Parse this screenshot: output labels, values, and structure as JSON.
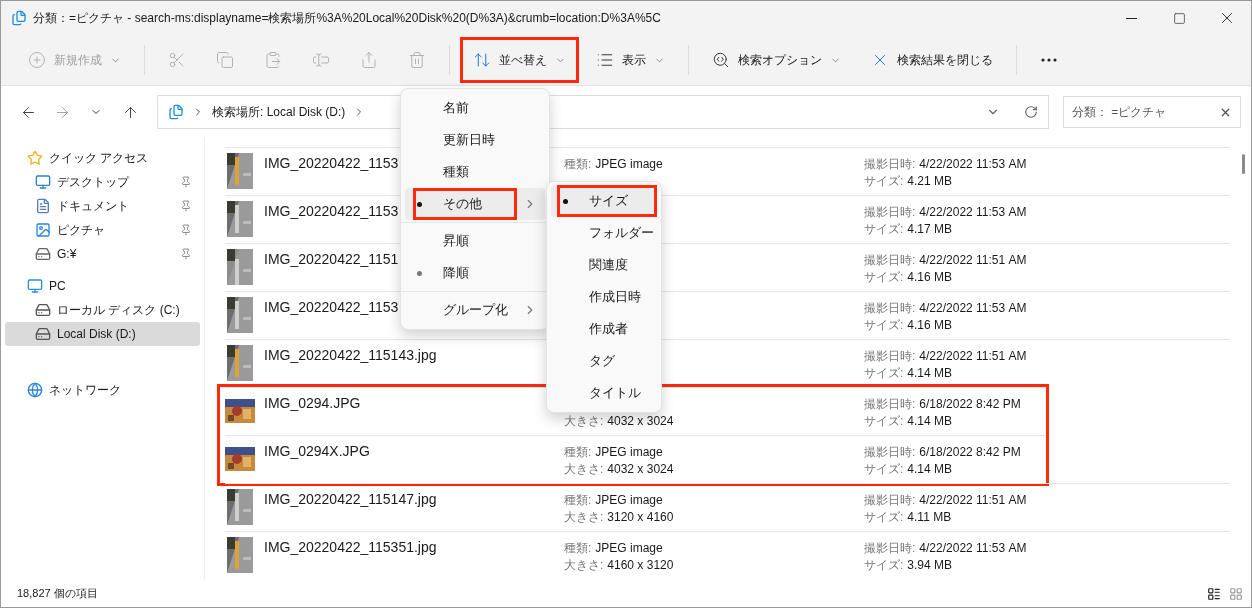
{
  "window": {
    "title": "分類：=ピクチャ - search-ms:displayname=検索場所%3A%20Local%20Disk%20(D%3A)&crumb=location:D%3A%5C"
  },
  "toolbar": [
    {
      "kind": "new",
      "label": "新規作成",
      "disabled": true,
      "dropdown": true,
      "highlighted": false
    },
    {
      "kind": "divider"
    },
    {
      "kind": "cut",
      "disabled": true
    },
    {
      "kind": "copy",
      "disabled": true
    },
    {
      "kind": "paste",
      "disabled": true
    },
    {
      "kind": "rename",
      "disabled": true
    },
    {
      "kind": "share",
      "disabled": true
    },
    {
      "kind": "delete",
      "disabled": true
    },
    {
      "kind": "divider"
    },
    {
      "kind": "sort",
      "label": "並べ替え",
      "disabled": false,
      "dropdown": true,
      "highlighted": true
    },
    {
      "kind": "view",
      "label": "表示",
      "disabled": false,
      "dropdown": true,
      "highlighted": false
    },
    {
      "kind": "divider"
    },
    {
      "kind": "search-options",
      "label": "検索オプション",
      "disabled": false,
      "dropdown": true,
      "highlighted": false
    },
    {
      "kind": "close-search",
      "label": "検索結果を閉じる",
      "disabled": false,
      "dropdown": false,
      "highlighted": false
    },
    {
      "kind": "divider"
    },
    {
      "kind": "more",
      "disabled": false
    }
  ],
  "address": {
    "crumbs": [
      "検索場所: Local Disk (D:)"
    ]
  },
  "search": {
    "value": "分類： =ピクチャ"
  },
  "sidebar": {
    "items": [
      {
        "kind": "star",
        "label": "クイック アクセス",
        "selected": false,
        "children": [
          {
            "kind": "desktop",
            "label": "デスクトップ",
            "pinned": true,
            "selected": false
          },
          {
            "kind": "documents",
            "label": "ドキュメント",
            "pinned": true,
            "selected": false
          },
          {
            "kind": "pictures",
            "label": "ピクチャ",
            "pinned": true,
            "selected": false
          },
          {
            "kind": "netdrive",
            "label": "G:¥",
            "pinned": true,
            "selected": false
          }
        ]
      },
      {
        "kind": "pc",
        "label": "PC",
        "selected": false,
        "children": [
          {
            "kind": "system-disk",
            "label": "ローカル ディスク (C:)",
            "pinned": false,
            "selected": false
          },
          {
            "kind": "disk",
            "label": "Local Disk (D:)",
            "pinned": false,
            "selected": true
          }
        ]
      },
      {
        "kind": "network",
        "label": "ネットワーク",
        "selected": false
      }
    ]
  },
  "files": [
    {
      "name": "IMG_20220422_1153",
      "type_label": "種類:",
      "type": "JPEG image",
      "date_label": "撮影日時:",
      "date": "4/22/2022 11:53 AM",
      "size_label": "サイズ:",
      "size": "4.21 MB",
      "highlighted": false
    },
    {
      "name": "IMG_20220422_1153",
      "date_label": "撮影日時:",
      "date": "4/22/2022 11:53 AM",
      "size_label": "サイズ:",
      "size": "4.17 MB",
      "highlighted": false
    },
    {
      "name": "IMG_20220422_1151",
      "date_label": "撮影日時:",
      "date": "4/22/2022 11:51 AM",
      "size_label": "サイズ:",
      "size": "4.16 MB",
      "highlighted": false
    },
    {
      "name": "IMG_20220422_1153",
      "date_label": "撮影日時:",
      "date": "4/22/2022 11:53 AM",
      "size_label": "サイズ:",
      "size": "4.16 MB",
      "highlighted": false
    },
    {
      "name": "IMG_20220422_115143.jpg",
      "date_label": "撮影日時:",
      "date": "4/22/2022 11:51 AM",
      "size_label": "サイズ:",
      "size": "4.14 MB",
      "highlighted": false
    },
    {
      "name": "IMG_0294.JPG",
      "dims_label": "大きさ:",
      "dims": "4032 x 3024",
      "date_label": "撮影日時:",
      "date": "6/18/2022 8:42 PM",
      "size_label": "サイズ:",
      "size": "4.14 MB",
      "highlighted": true
    },
    {
      "name": "IMG_0294X.JPG",
      "type_label": "種類:",
      "type": "JPEG image",
      "dims_label": "大きさ:",
      "dims": "4032 x 3024",
      "date_label": "撮影日時:",
      "date": "6/18/2022 8:42 PM",
      "size_label": "サイズ:",
      "size": "4.14 MB",
      "highlighted": true
    },
    {
      "name": "IMG_20220422_115147.jpg",
      "type_label": "種類:",
      "type": "JPEG image",
      "dims_label": "大きさ:",
      "dims": "3120 x 4160",
      "date_label": "撮影日時:",
      "date": "4/22/2022 11:51 AM",
      "size_label": "サイズ:",
      "size": "4.11 MB",
      "highlighted": false
    },
    {
      "name": "IMG_20220422_115351.jpg",
      "type_label": "種類:",
      "type": "JPEG image",
      "dims_label": "大きさ:",
      "dims": "4160 x 3120",
      "date_label": "撮影日時:",
      "date": "4/22/2022 11:53 AM",
      "size_label": "サイズ:",
      "size": "3.94 MB",
      "highlighted": false
    }
  ],
  "sort_menu": {
    "items": [
      {
        "kind": "item",
        "label": "名前",
        "selected": false,
        "hovered": false,
        "submenu": false,
        "highlighted": false
      },
      {
        "kind": "item",
        "label": "更新日時",
        "selected": false,
        "hovered": false,
        "submenu": false,
        "highlighted": false
      },
      {
        "kind": "item",
        "label": "種類",
        "selected": false,
        "hovered": false,
        "submenu": false,
        "highlighted": false
      },
      {
        "kind": "item",
        "label": "その他",
        "selected": true,
        "hovered": true,
        "submenu": true,
        "highlighted": true
      },
      {
        "kind": "separator"
      },
      {
        "kind": "item",
        "label": "昇順",
        "selected": false,
        "hovered": false,
        "submenu": false,
        "highlighted": false
      },
      {
        "kind": "item",
        "label": "降順",
        "selected": true,
        "hovered": false,
        "submenu": false,
        "highlighted": false
      },
      {
        "kind": "separator"
      },
      {
        "kind": "item",
        "label": "グループ化",
        "selected": false,
        "hovered": false,
        "submenu": true,
        "highlighted": false
      }
    ]
  },
  "more_menu": {
    "items": [
      {
        "kind": "item",
        "label": "サイズ",
        "selected": true,
        "hovered": true,
        "submenu": false,
        "highlighted": true
      },
      {
        "kind": "item",
        "label": "フォルダー",
        "selected": false,
        "hovered": false,
        "submenu": false,
        "highlighted": false
      },
      {
        "kind": "item",
        "label": "関連度",
        "selected": false,
        "hovered": false,
        "submenu": false,
        "highlighted": false
      },
      {
        "kind": "item",
        "label": "作成日時",
        "selected": false,
        "hovered": false,
        "submenu": false,
        "highlighted": false
      },
      {
        "kind": "item",
        "label": "作成者",
        "selected": false,
        "hovered": false,
        "submenu": false,
        "highlighted": false
      },
      {
        "kind": "item",
        "label": "タグ",
        "selected": false,
        "hovered": false,
        "submenu": false,
        "highlighted": false
      },
      {
        "kind": "item",
        "label": "タイトル",
        "selected": false,
        "hovered": false,
        "submenu": false,
        "highlighted": false
      }
    ]
  },
  "status_bar": {
    "count": "18,827 個の項目"
  }
}
